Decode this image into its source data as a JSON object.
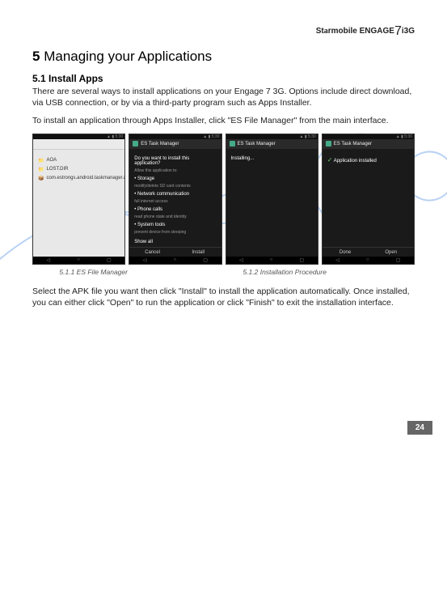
{
  "brand": "Starmobile ENGAGE 7i 3G",
  "section": {
    "num": "5",
    "title": "Managing your Applications"
  },
  "subsection": {
    "num": "5.1",
    "title": "Install Apps"
  },
  "para1": "There are several ways to install applications on your Engage 7 3G. Options include direct download, via USB connection, or by via a third-party program such as Apps Installer.",
  "para2": "To install an application through Apps Installer, click \"ES File Manager\" from the main interface.",
  "para3": "Select the APK file you want then click \"Install\" to install the application automatically. Once installed, you can either click \"Open\" to run the application or click \"Finish\" to exit the installation interface.",
  "captions": {
    "left": "5.1.1 ES File Manager",
    "right": "5.1.2 Installation Procedure"
  },
  "screens": {
    "s1": {
      "items": [
        "AOA",
        "LOST.DIR",
        "com.estrongs.android.taskmanager.apk"
      ]
    },
    "s2": {
      "title": "ES Task Manager",
      "prompt": "Do you want to install this application?",
      "allow": "Allow this application to:",
      "perms": [
        "Storage",
        "Network communication",
        "Phone calls",
        "System tools"
      ],
      "showall": "Show all",
      "cancel": "Cancel",
      "install": "Install"
    },
    "s3": {
      "title": "ES Task Manager",
      "status": "Installing..."
    },
    "s4": {
      "title": "ES Task Manager",
      "status": "Application installed",
      "done": "Done",
      "open": "Open"
    }
  },
  "pagenum": "24"
}
